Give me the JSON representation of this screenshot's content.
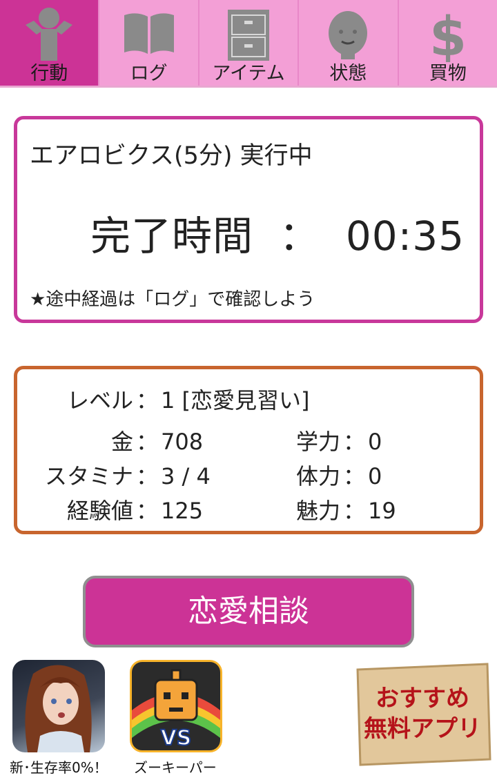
{
  "tabs": [
    {
      "label": "行動",
      "icon": "person-icon",
      "active": true
    },
    {
      "label": "ログ",
      "icon": "book-icon",
      "active": false
    },
    {
      "label": "アイテム",
      "icon": "drawer-icon",
      "active": false
    },
    {
      "label": "状態",
      "icon": "face-icon",
      "active": false
    },
    {
      "label": "買物",
      "icon": "dollar-icon",
      "active": false
    }
  ],
  "action": {
    "status": "エアロビクス(5分) 実行中",
    "time_label": "完了時間",
    "time_sep": "：",
    "time_value": "00:35",
    "note": "★途中経過は「ログ」で確認しよう"
  },
  "stats": {
    "level": {
      "key": "レベル",
      "sep": "：",
      "value": "1 [恋愛見習い]"
    },
    "money": {
      "key": "金",
      "sep": "：",
      "value": "708"
    },
    "stamina": {
      "key": "スタミナ",
      "sep": "：",
      "value": "3 / 4"
    },
    "exp": {
      "key": "経験値",
      "sep": "：",
      "value": "125"
    },
    "study": {
      "key": "学力",
      "sep": "：",
      "value": "0"
    },
    "physical": {
      "key": "体力",
      "sep": "：",
      "value": "0"
    },
    "charm": {
      "key": "魅力",
      "sep": "：",
      "value": "19"
    }
  },
  "consult_button": "恋愛相談",
  "ads": [
    {
      "label": "新･生存率0%！"
    },
    {
      "label": "ズーキーパー"
    }
  ],
  "recommend": {
    "line1": "おすすめ",
    "line2": "無料アプリ"
  },
  "colors": {
    "accent": "#cc3396",
    "tab_bg": "#f39fd6",
    "panel1_border": "#c8389a",
    "panel2_border": "#c8652e",
    "recommend_text": "#b5131a"
  }
}
